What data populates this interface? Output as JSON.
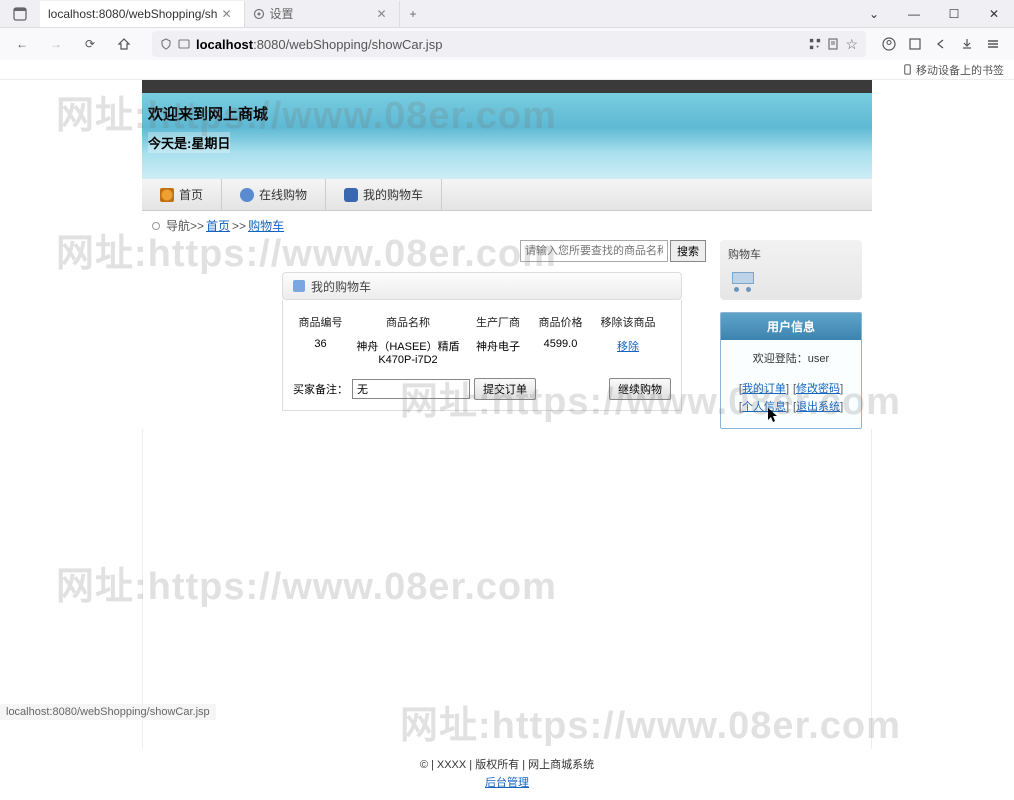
{
  "browser": {
    "tabs": [
      {
        "title": "localhost:8080/webShopping/sh"
      },
      {
        "title": "设置"
      }
    ],
    "url_prefix": "localhost",
    "url_rest": ":8080/webShopping/showCar.jsp",
    "bookmarks_bar": "移动设备上的书签",
    "chevron": "⌄",
    "minimize": "—",
    "maximize": "☐",
    "close": "✕",
    "plus": "+",
    "back": "←",
    "forward": "→",
    "reload": "⟳"
  },
  "banner": {
    "title": "欢迎来到网上商城",
    "today": "今天是:星期日"
  },
  "menu": {
    "home": "首页",
    "shop": "在线购物",
    "cart": "我的购物车"
  },
  "breadcrumb": {
    "label": "导航>>",
    "home": "首页",
    "sep": ">>",
    "cart": "购物车"
  },
  "search": {
    "placeholder": "请输入您所要查找的商品名称",
    "button": "搜索"
  },
  "cart_panel": {
    "title": "我的购物车",
    "headers": {
      "id": "商品编号",
      "name": "商品名称",
      "vendor": "生产厂商",
      "price": "商品价格",
      "remove": "移除该商品"
    },
    "row": {
      "id": "36",
      "name": "神舟（HASEE）精盾K470P-i7D2",
      "vendor": "神舟电子",
      "price": "4599.0",
      "remove": "移除"
    },
    "note_label": "买家备注：",
    "note_value": "无",
    "submit": "提交订单",
    "continue": "继续购物"
  },
  "sidebar": {
    "cart_title": "购物车",
    "user_title": "用户信息",
    "welcome_label": "欢迎登陆：",
    "username": "user",
    "links": {
      "orders": "我的订单",
      "password": "修改密码",
      "profile": "个人信息",
      "logout": "退出系统"
    }
  },
  "footer": {
    "line1": "© | XXXX | 版权所有 | 网上商城系统",
    "admin": "后台管理"
  },
  "status_bar": "localhost:8080/webShopping/showCar.jsp",
  "watermark": "网址:https://www.08er.com"
}
